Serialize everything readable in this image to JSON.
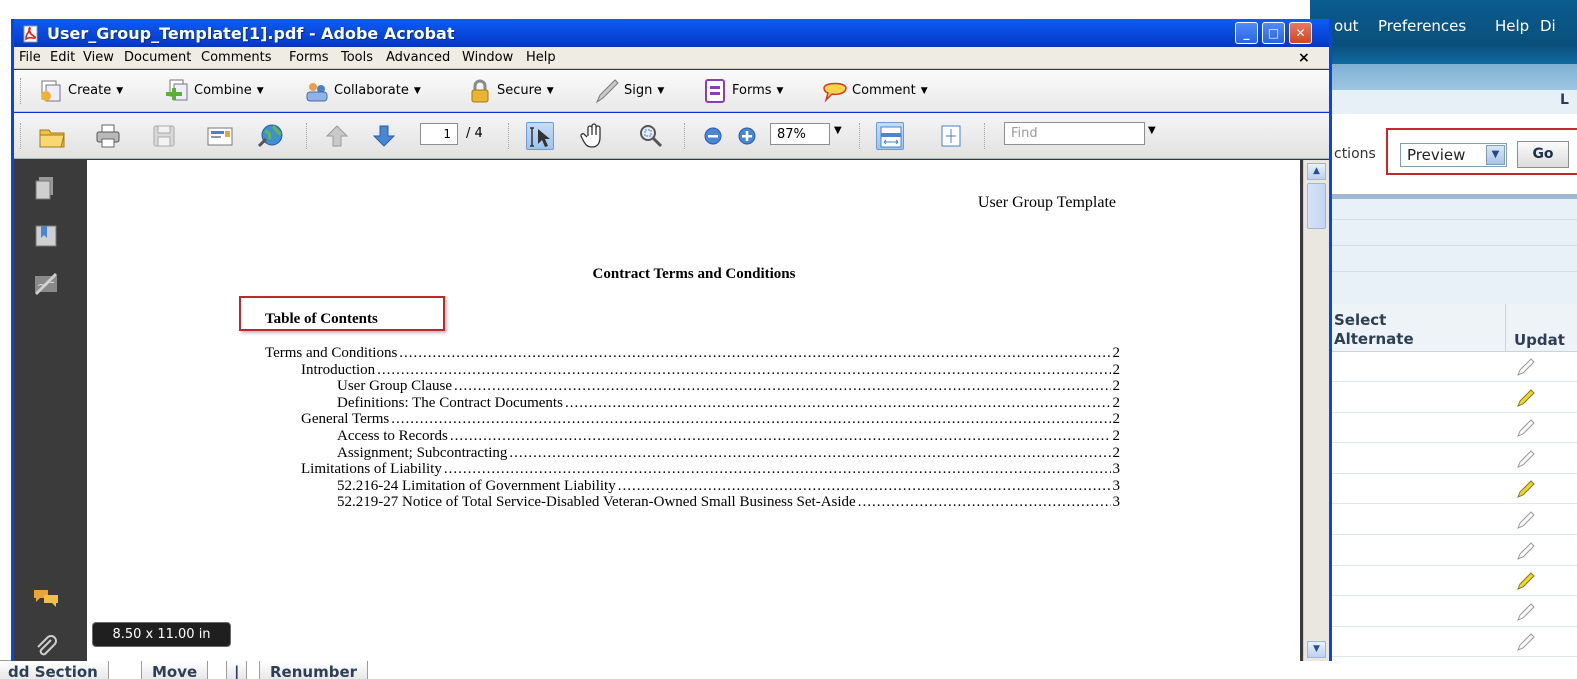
{
  "background_app": {
    "top_nav": [
      "out",
      "Preferences",
      "Help",
      "Di"
    ],
    "band_letter": "L",
    "actions_label": "ctions",
    "actions_select_value": "Preview",
    "go_button": "Go",
    "table_headers": {
      "select_alternate": "Select\nAlternate",
      "update": "Updat"
    },
    "rows": [
      {
        "pencil": "inactive"
      },
      {
        "pencil": "active"
      },
      {
        "pencil": "inactive"
      },
      {
        "pencil": "inactive"
      },
      {
        "pencil": "active"
      },
      {
        "pencil": "inactive"
      },
      {
        "pencil": "inactive"
      },
      {
        "pencil": "active"
      },
      {
        "pencil": "inactive"
      },
      {
        "pencil": "inactive"
      }
    ],
    "bottom_buttons": [
      "dd Section",
      "Move",
      "|",
      "Renumber"
    ],
    "colors": {
      "nav": "#0a5c8e",
      "highlight": "#c8272d"
    }
  },
  "acrobat": {
    "window_title": "User_Group_Template[1].pdf - Adobe Acrobat",
    "window_buttons": {
      "minimize": "_",
      "maximize": "□",
      "close": "✕"
    },
    "menu": [
      "File",
      "Edit",
      "View",
      "Document",
      "Comments",
      "Forms",
      "Tools",
      "Advanced",
      "Window",
      "Help"
    ],
    "doc_close": "×",
    "tasks": [
      {
        "label": "Create",
        "icon": "create-icon"
      },
      {
        "label": "Combine",
        "icon": "combine-icon"
      },
      {
        "label": "Collaborate",
        "icon": "collaborate-icon"
      },
      {
        "label": "Secure",
        "icon": "lock-icon"
      },
      {
        "label": "Sign",
        "icon": "pen-icon"
      },
      {
        "label": "Forms",
        "icon": "form-icon"
      },
      {
        "label": "Comment",
        "icon": "comment-bubble-icon"
      }
    ],
    "page_current": "1",
    "page_total": "/ 4",
    "zoom": "87%",
    "find_placeholder": "Find",
    "page_size_label": "8.50 x 11.00 in",
    "colors": {
      "titlebar": "#0a4be0",
      "nav_pane": "#3b3b3b"
    }
  },
  "document": {
    "header": "User Group Template",
    "title": "Contract Terms and Conditions",
    "toc_heading": "Table of Contents",
    "toc": [
      {
        "level": 1,
        "text": "Terms and Conditions",
        "page": "2"
      },
      {
        "level": 2,
        "text": "Introduction",
        "page": "2"
      },
      {
        "level": 3,
        "text": "User Group Clause",
        "page": "2"
      },
      {
        "level": 3,
        "text": "Definitions: The Contract Documents",
        "page": "2"
      },
      {
        "level": 2,
        "text": "General Terms",
        "page": "2"
      },
      {
        "level": 3,
        "text": "Access to Records",
        "page": "2"
      },
      {
        "level": 3,
        "text": "Assignment; Subcontracting",
        "page": "2"
      },
      {
        "level": 2,
        "text": "Limitations of Liability",
        "page": "3"
      },
      {
        "level": 3,
        "text": "52.216-24 Limitation of Government Liability",
        "page": "3"
      },
      {
        "level": 3,
        "text": "52.219-27 Notice of Total Service-Disabled Veteran-Owned Small Business Set-Aside",
        "page": "3"
      }
    ]
  }
}
